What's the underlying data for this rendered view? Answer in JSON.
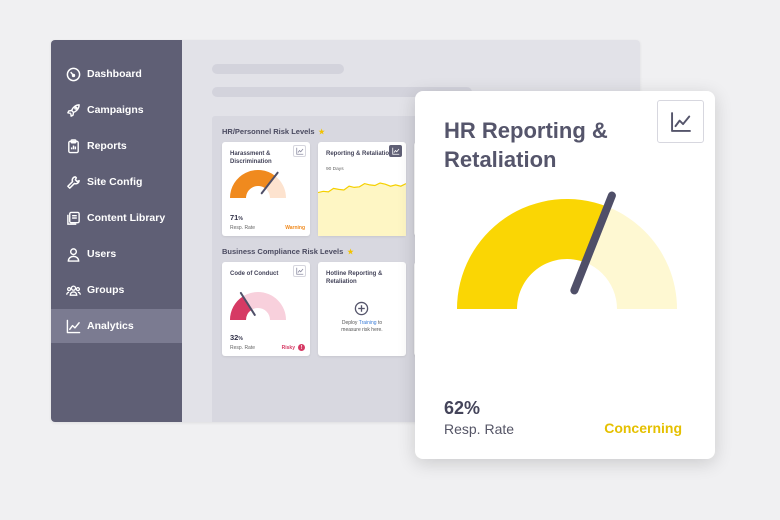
{
  "sidebar": {
    "items": [
      {
        "label": "Dashboard",
        "icon": "dashboard-gauge-icon"
      },
      {
        "label": "Campaigns",
        "icon": "rocket-icon"
      },
      {
        "label": "Reports",
        "icon": "clipboard-icon"
      },
      {
        "label": "Site Config",
        "icon": "wrench-icon"
      },
      {
        "label": "Content Library",
        "icon": "library-icon"
      },
      {
        "label": "Users",
        "icon": "user-icon"
      },
      {
        "label": "Groups",
        "icon": "groups-icon"
      },
      {
        "label": "Analytics",
        "icon": "analytics-chart-icon",
        "active": true
      }
    ]
  },
  "sections": {
    "hr": {
      "title": "HR/Personnel Risk Levels"
    },
    "business": {
      "title": "Business Compliance Risk Levels"
    }
  },
  "cards": {
    "harassment": {
      "title": "Harassment & Discrimination",
      "value": "71",
      "unit": "%",
      "sub": "Resp. Rate",
      "status": "Warning",
      "rate": 0.71,
      "color": "#f08a1e",
      "light": "#fde3cf"
    },
    "reporting": {
      "title": "Reporting & Retaliation",
      "period": "90 Days"
    },
    "conduct": {
      "title": "Code of Conduct",
      "value": "32",
      "unit": "%",
      "sub": "Resp. Rate",
      "status": "Risky",
      "badge": "!",
      "rate": 0.32,
      "color": "#d63a64",
      "light": "#f8d0dc"
    },
    "hotline": {
      "title": "Hotline Reporting & Retaliation",
      "deploy_pre": "Deploy ",
      "deploy_link": "Training",
      "deploy_post": " to measure risk here."
    }
  },
  "detail": {
    "title": "HR Reporting & Retaliation",
    "value": "62%",
    "sub": "Resp. Rate",
    "status": "Concerning",
    "rate": 0.62,
    "color": "#fad604",
    "light": "#fef8d2",
    "needle_color": "#4f4f68"
  },
  "trend": {
    "period_days": 90,
    "values": [
      0.42,
      0.46,
      0.44,
      0.55,
      0.52,
      0.5,
      0.62,
      0.58,
      0.6,
      0.7,
      0.66,
      0.64,
      0.72,
      0.68,
      0.62,
      0.66,
      0.62,
      0.7
    ],
    "color": "#f5d000"
  }
}
